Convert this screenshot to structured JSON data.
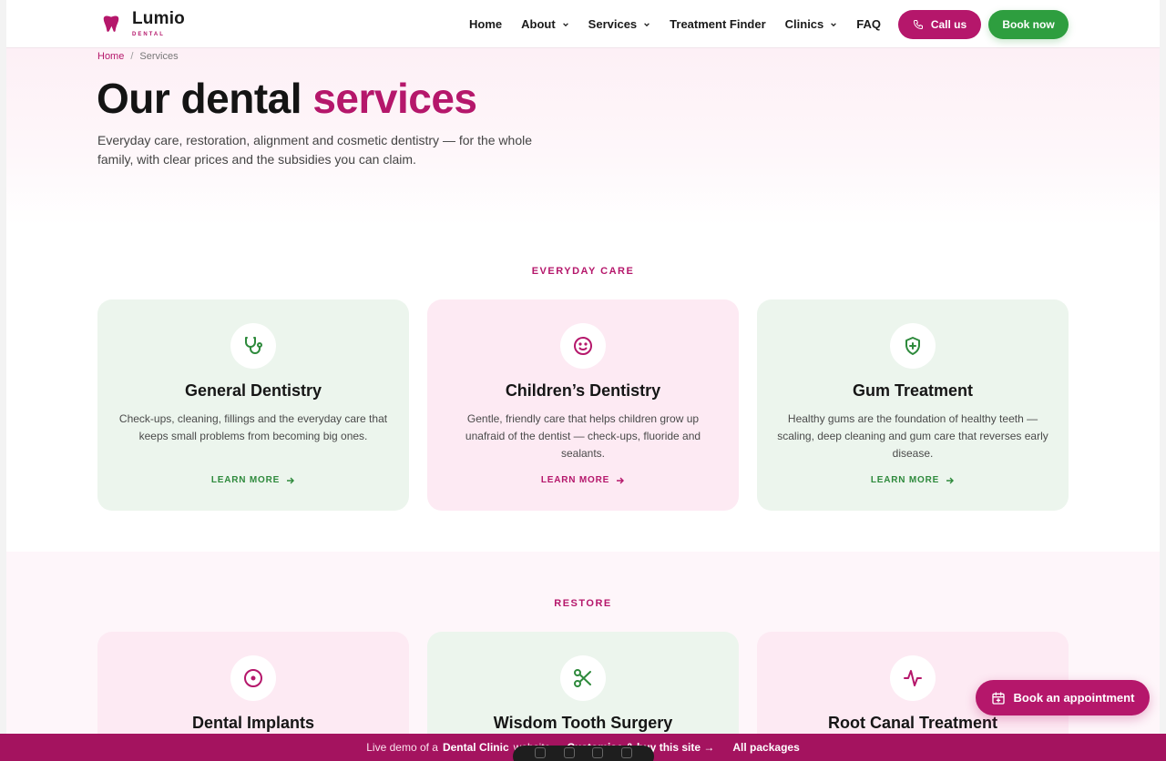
{
  "brand": {
    "name": "Lumio",
    "subtitle": "DENTAL",
    "color": "#b5176b"
  },
  "nav": {
    "items": [
      {
        "label": "Home",
        "dropdown": false
      },
      {
        "label": "About",
        "dropdown": true
      },
      {
        "label": "Services",
        "dropdown": true
      },
      {
        "label": "Treatment Finder",
        "dropdown": false
      },
      {
        "label": "Clinics",
        "dropdown": true
      },
      {
        "label": "FAQ",
        "dropdown": false
      }
    ],
    "call_label": "Call us",
    "book_label": "Book now"
  },
  "breadcrumb": {
    "home": "Home",
    "separator": "/",
    "current": "Services"
  },
  "hero": {
    "title_plain": "Our dental",
    "title_accent": "services",
    "description": "Everyday care, restoration, alignment and cosmetic dentistry — for the whole family, with clear prices and the subsidies you can claim."
  },
  "sections": [
    {
      "label": "EVERYDAY CARE",
      "cards": [
        {
          "icon": "stethoscope-icon",
          "title": "General Dentistry",
          "description": "Check-ups, cleaning, fillings and the everyday care that keeps small problems from becoming big ones.",
          "link": "LEARN MORE",
          "theme": "green"
        },
        {
          "icon": "smile-face-icon",
          "title": "Children’s Dentistry",
          "description": "Gentle, friendly care that helps children grow up unafraid of the dentist — check-ups, fluoride and sealants.",
          "link": "LEARN MORE",
          "theme": "pink"
        },
        {
          "icon": "shield-plus-icon",
          "title": "Gum Treatment",
          "description": "Healthy gums are the foundation of healthy teeth — scaling, deep cleaning and gum care that reverses early disease.",
          "link": "LEARN MORE",
          "theme": "green"
        }
      ]
    },
    {
      "label": "RESTORE",
      "cards": [
        {
          "icon": "target-icon",
          "title": "Dental Implants",
          "theme": "pink"
        },
        {
          "icon": "scissors-icon",
          "title": "Wisdom Tooth Surgery",
          "theme": "green"
        },
        {
          "icon": "pulse-icon",
          "title": "Root Canal Treatment",
          "theme": "pink"
        }
      ]
    }
  ],
  "floating": {
    "book_appointment": "Book an appointment"
  },
  "demo_bar": {
    "prefix": "Live demo of a",
    "site_type": "Dental Clinic",
    "suffix": "website",
    "cta": "Customise & buy this site →",
    "packages": "All packages"
  },
  "colors": {
    "accent_pink": "#b5176b",
    "accent_green": "#2e9e3f",
    "card_green": "#ecf5ed",
    "card_pink": "#fdeaf3"
  }
}
